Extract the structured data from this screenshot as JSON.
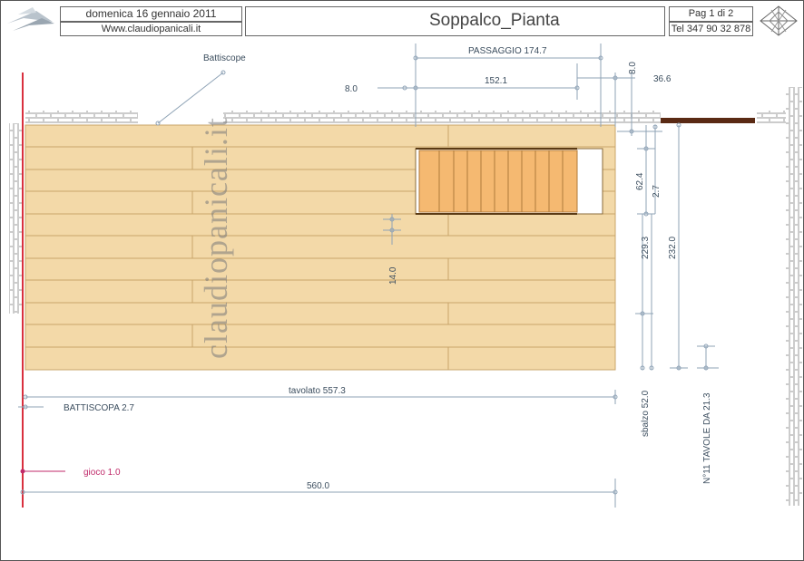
{
  "header": {
    "date": "domenica 16 gennaio 2011",
    "website": "Www.claudiopanicali.it",
    "title": "Soppalco_Pianta",
    "page": "Pag 1 di 2",
    "phone": "Tel 347 90 32 878"
  },
  "watermark": "claudiopanicali.it",
  "labels": {
    "battiscope": "Battiscope",
    "passaggio": "PASSAGGIO 174.7",
    "dim_8_left": "8.0",
    "dim_152": "152.1",
    "dim_8_top": "8.0",
    "dim_36": "36.6",
    "dim_62": "62.4",
    "dim_2_7": "2.7",
    "dim_229": "229.3",
    "dim_232": "232.0",
    "dim_14": "14.0",
    "tavolato": "tavolato 557.3",
    "battiscopa": "BATTISCOPA 2.7",
    "sbalzo": "sbalzo 52.0",
    "tavole": "N°11 TAVOLE DA 21.3",
    "gioco": "gioco 1.0",
    "dim_560": "560.0"
  },
  "colors": {
    "wood": "#f3d9a8",
    "wood_line": "#c8a56a",
    "stair": "#f5b971",
    "dim_line": "#8fa3b6",
    "red_line": "#d9303e",
    "gioco": "#c02a6a",
    "beam": "#5a2a14"
  }
}
